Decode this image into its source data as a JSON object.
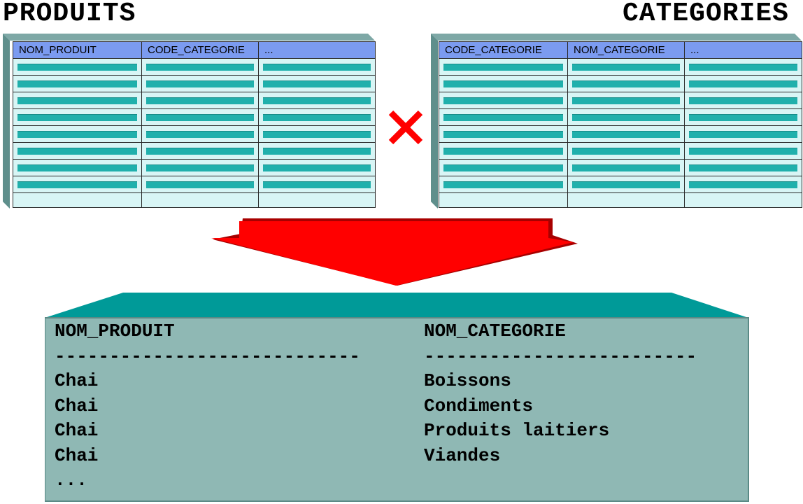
{
  "titles": {
    "left": "PRODUITS",
    "right": "CATEGORIES"
  },
  "produits_table": {
    "columns": [
      "NOM_PRODUIT",
      "CODE_CATEGORIE",
      "..."
    ],
    "filled_rows": 8,
    "empty_rows": 1
  },
  "categories_table": {
    "columns": [
      "CODE_CATEGORIE",
      "NOM_CATEGORIE",
      "..."
    ],
    "filled_rows": 8,
    "empty_rows": 1
  },
  "operator": {
    "icon": "cross-product-icon",
    "color": "#ff0000"
  },
  "arrow": {
    "icon": "down-arrow-icon",
    "color": "#ff0000"
  },
  "result": {
    "header": [
      "NOM_PRODUIT",
      "NOM_CATEGORIE"
    ],
    "separator": [
      "----------------------------",
      "-------------------------"
    ],
    "rows": [
      [
        "Chai",
        "Boissons"
      ],
      [
        "Chai",
        "Condiments"
      ],
      [
        "Chai",
        "Produits laitiers"
      ],
      [
        "Chai",
        "Viandes"
      ],
      [
        "...",
        ""
      ]
    ]
  },
  "colors": {
    "header_blue": "#7b9bf0",
    "row_bar_teal": "#20b0ac",
    "table_bg": "#d8f5f5",
    "result_bg": "#8fb8b4",
    "result_top": "#009a98"
  }
}
